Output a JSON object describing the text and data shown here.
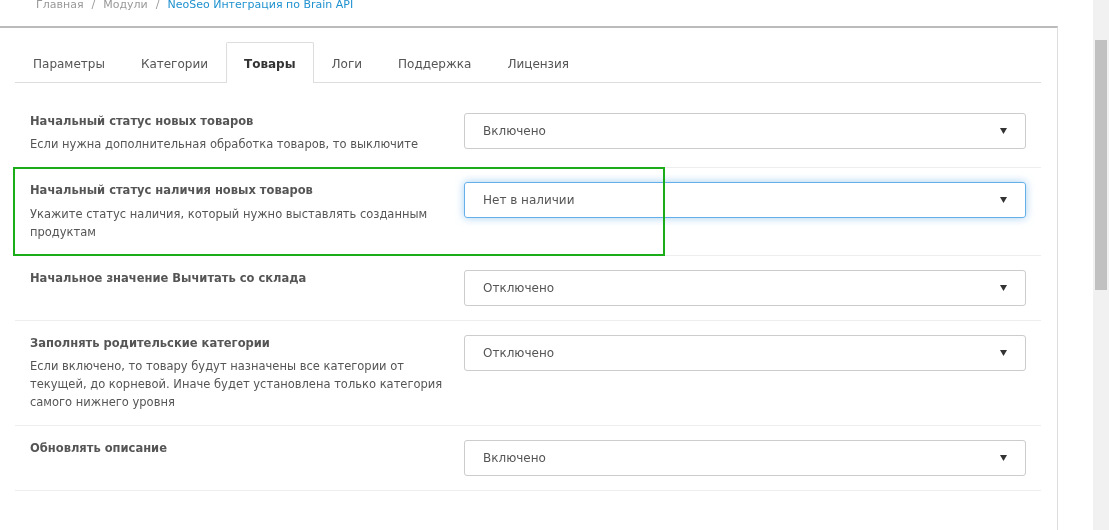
{
  "breadcrumb": {
    "separator": "/",
    "items": [
      {
        "label": "Главная",
        "current": false
      },
      {
        "label": "Модули",
        "current": false
      },
      {
        "label": "NeoSeo Интеграция по Brain API",
        "current": true
      }
    ]
  },
  "tabs": [
    {
      "label": "Параметры",
      "selected": false
    },
    {
      "label": "Категории",
      "selected": false
    },
    {
      "label": "Товары",
      "selected": true
    },
    {
      "label": "Логи",
      "selected": false
    },
    {
      "label": "Поддержка",
      "selected": false
    },
    {
      "label": "Лицензия",
      "selected": false
    }
  ],
  "settings": [
    {
      "label": "Начальный статус новых товаров",
      "help": "Если нужна дополнительная обработка товаров, то выключите",
      "value": "Включено",
      "focused": false,
      "highlighted": false
    },
    {
      "label": "Начальный статус наличия новых товаров",
      "help": "Укажите статус наличия, который нужно выставлять созданным продуктам",
      "value": "Нет в наличии",
      "focused": true,
      "highlighted": true
    },
    {
      "label": "Начальное значение Вычитать со склада",
      "value": "Отключено",
      "focused": false,
      "highlighted": false
    },
    {
      "label": "Заполнять родительские категории",
      "help": "Если включено, то товару будут назначены все категории от текущей, до корневой. Иначе будет установлена только категория самого нижнего уровня",
      "value": "Отключено",
      "focused": false,
      "highlighted": false
    },
    {
      "label": "Обновлять описание",
      "value": "Включено",
      "focused": false,
      "highlighted": false
    }
  ]
}
